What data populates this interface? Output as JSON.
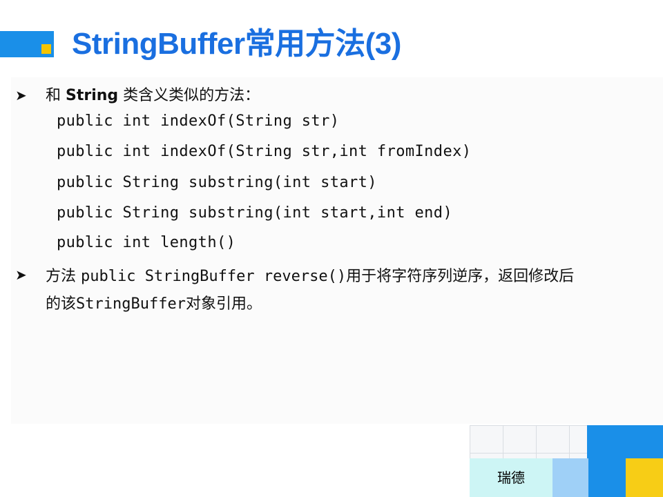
{
  "slide": {
    "title": "StringBuffer常用方法(3)",
    "bullets": [
      {
        "marker": "➤",
        "prefix": "和 ",
        "emphasis": "String",
        "suffix": " 类含义类似的方法：",
        "code_lines": [
          "public int indexOf(String str)",
          "public int indexOf(String str,int fromIndex)",
          "public String substring(int start)",
          "public String substring(int start,int end)",
          "public int length()"
        ]
      },
      {
        "marker": "➤",
        "prefix": "方法 ",
        "code": "public StringBuffer reverse()",
        "suffix": "用于将字符序列逆序，返回修改后",
        "line2_prefix": "的该",
        "line2_code": "StringBuffer",
        "line2_suffix": "对象引用。"
      }
    ],
    "footer": "瑞德"
  },
  "colors": {
    "title": "#1a6fe0",
    "accent_blue": "#1a8fe8",
    "accent_yellow": "#f7cd16",
    "accent_light_blue": "#9fd0f7",
    "accent_cyan": "#cdf5f5"
  }
}
